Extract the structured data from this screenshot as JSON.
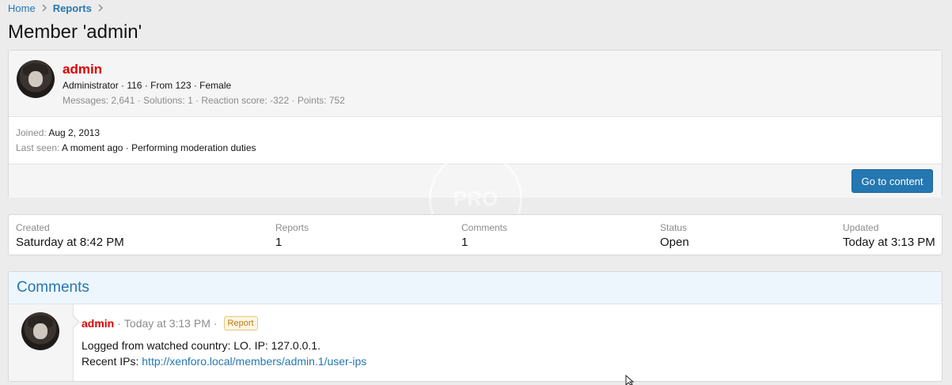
{
  "breadcrumb": {
    "home": "Home",
    "reports": "Reports",
    "sep_icon": "chevron-right"
  },
  "page_title": "Member 'admin'",
  "member": {
    "name": "admin",
    "line1": "Administrator · 116 · From 123 · Female",
    "line2": "Messages: 2,641 · Solutions: 1 · Reaction score: -322 · Points: 752",
    "joined_label": "Joined:",
    "joined_value": "Aug 2, 2013",
    "last_seen_label": "Last seen:",
    "last_seen_value": "A moment ago · Performing moderation duties",
    "go_button": "Go to content"
  },
  "watermark": "PRO",
  "stats": {
    "created_label": "Created",
    "created_value": "Saturday at 8:42 PM",
    "reports_label": "Reports",
    "reports_value": "1",
    "comments_label": "Comments",
    "comments_value": "1",
    "status_label": "Status",
    "status_value": "Open",
    "updated_label": "Updated",
    "updated_value": "Today at 3:13 PM"
  },
  "comments": {
    "title": "Comments",
    "items": [
      {
        "author": "admin",
        "separator": "·",
        "time": "Today at 3:13 PM",
        "badge": "Report",
        "line1": "Logged from watched country: LO. IP: 127.0.0.1.",
        "line2_prefix": "Recent IPs: ",
        "line2_link": "http://xenforo.local/members/admin.1/user-ips"
      }
    ]
  },
  "colors": {
    "accent": "#2577b1",
    "admin_name": "#e00000",
    "badge": "#b87a12"
  }
}
